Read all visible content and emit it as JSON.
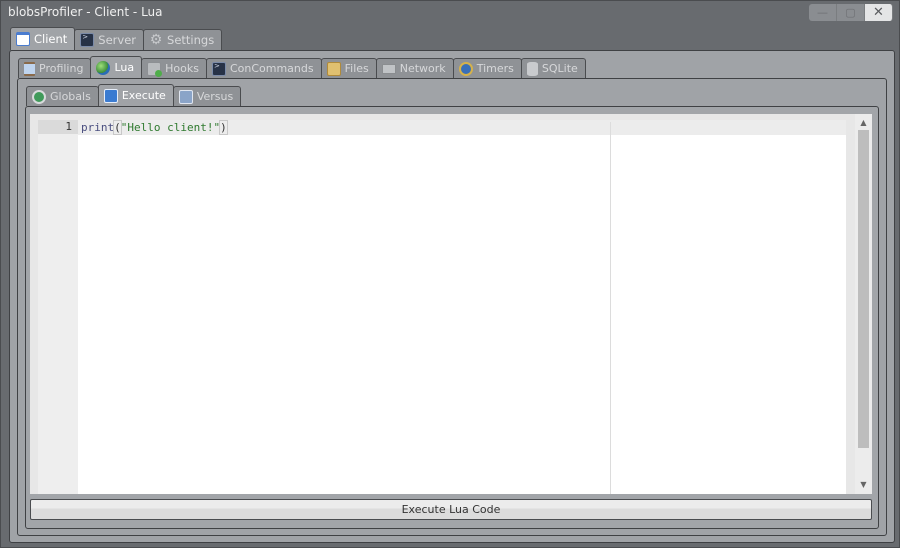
{
  "window": {
    "title": "blobsProfiler - Client - Lua",
    "controls": {
      "minimize": "—",
      "maximize": "▢",
      "close": "✕"
    }
  },
  "realm_tabs": [
    {
      "label": "Client",
      "icon": "window-icon",
      "active": true
    },
    {
      "label": "Server",
      "icon": "console-icon",
      "active": false
    },
    {
      "label": "Settings",
      "icon": "gear-icon",
      "active": false
    }
  ],
  "module_tabs": [
    {
      "label": "Profiling",
      "icon": "hourglass-icon",
      "active": false
    },
    {
      "label": "Lua",
      "icon": "globe-icon",
      "active": true
    },
    {
      "label": "Hooks",
      "icon": "hooks-icon",
      "active": false
    },
    {
      "label": "ConCommands",
      "icon": "console-icon",
      "active": false
    },
    {
      "label": "Files",
      "icon": "files-icon",
      "active": false
    },
    {
      "label": "Network",
      "icon": "network-icon",
      "active": false
    },
    {
      "label": "Timers",
      "icon": "alarm-clock-icon",
      "active": false
    },
    {
      "label": "SQLite",
      "icon": "database-icon",
      "active": false
    }
  ],
  "lua_tabs": [
    {
      "label": "Globals",
      "icon": "globe-document-icon",
      "active": false
    },
    {
      "label": "Execute",
      "icon": "execute-icon",
      "active": true
    },
    {
      "label": "Versus",
      "icon": "versus-icon",
      "active": false
    }
  ],
  "editor": {
    "lines": [
      {
        "number": "1",
        "func": "print",
        "open": "(",
        "string": "\"Hello client!\"",
        "close": ")"
      }
    ],
    "scroll_up": "▲",
    "scroll_down": "▼"
  },
  "execute_button": {
    "label": "Execute Lua Code"
  }
}
